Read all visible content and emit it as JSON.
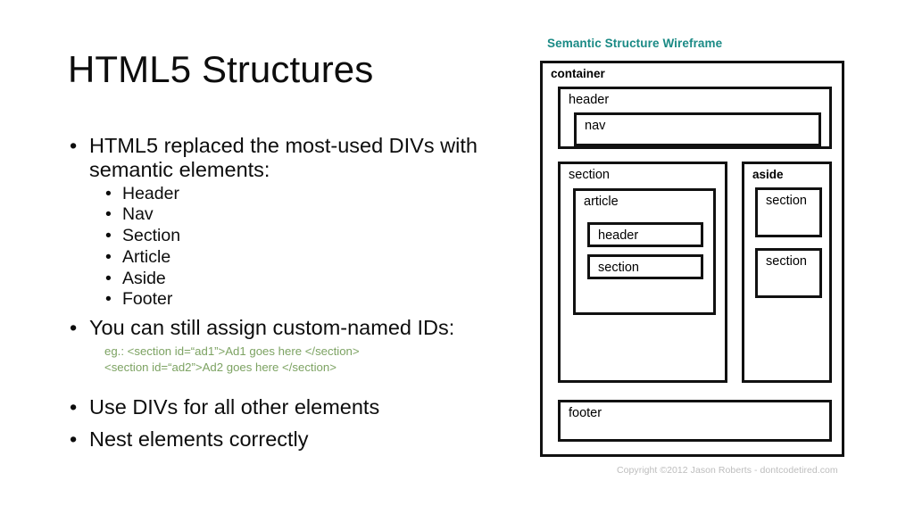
{
  "slide": {
    "title": "HTML5 Structures",
    "bullets": [
      {
        "text": "HTML5 replaced the most-used DIVs with semantic elements:",
        "sub": [
          "Header",
          "Nav",
          "Section",
          "Article",
          "Aside",
          "Footer"
        ]
      },
      {
        "text": "You can still assign custom-named IDs:",
        "code": [
          "eg.: <section id=“ad1”>Ad1 goes here </section>",
          "<section id=“ad2”>Ad2 goes here </section>"
        ]
      },
      {
        "text": "Use DIVs for all other elements"
      },
      {
        "text": "Nest elements correctly"
      }
    ],
    "bullet_glyph": "•"
  },
  "wireframe": {
    "title": "Semantic Structure Wireframe",
    "copyright": "Copyright ©2012 Jason Roberts - dontcodetired.com",
    "labels": {
      "container": "container",
      "header": "header",
      "nav": "nav",
      "section_main": "section",
      "article": "article",
      "article_header": "header",
      "article_section": "section",
      "aside": "aside",
      "aside_section_1": "section",
      "aside_section_2": "section",
      "footer": "footer"
    }
  },
  "colors": {
    "title_teal": "#1a8a85",
    "code_green": "#7da363",
    "copyright_gray": "#bdbdbd",
    "box_border": "#111111",
    "text": "#0d0d0d",
    "background": "#ffffff"
  }
}
